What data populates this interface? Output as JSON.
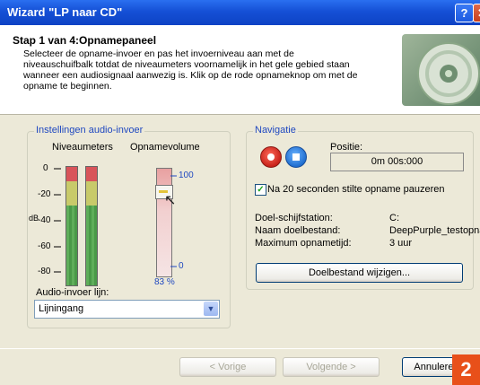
{
  "window": {
    "title": "Wizard \"LP naar CD\"",
    "help_glyph": "?",
    "close_glyph": "✕"
  },
  "header": {
    "step": "Stap 1 van 4:Opnamepaneel",
    "desc_line1": "Selecteer de opname-invoer en pas het invoerniveau aan met de",
    "desc_line2": "niveauschuifbalk totdat de niveaumeters voornamelijk in het gele gebied staan",
    "desc_line3": "wanneer een audiosignaal aanwezig is. Klik op de rode opnameknop om met de",
    "desc_line4": "opname te beginnen."
  },
  "audio_input": {
    "group_title": "Instellingen audio-invoer",
    "meters_label": "Niveaumeters",
    "volume_label": "Opnamevolume",
    "db_unit": "dB",
    "ticks": [
      "0",
      "-20",
      "-40",
      "-60",
      "-80"
    ],
    "volume_max": "100",
    "volume_min": "0",
    "volume_percent": "83 %",
    "volume_value": 83,
    "input_line_label": "Audio-invoer lijn:",
    "input_line_value": "Lijningang"
  },
  "navigation": {
    "group_title": "Navigatie",
    "position_label": "Positie:",
    "position_value": "0m 00s:000",
    "pause_checked": true,
    "pause_label": "Na 20 seconden stilte opname pauzeren",
    "target_drive_label": "Doel-schijfstation:",
    "target_drive_value": "C:",
    "target_file_label": "Naam doelbestand:",
    "target_file_value": "DeepPurple_testopna",
    "max_time_label": "Maximum opnametijd:",
    "max_time_value": "3 uur",
    "change_target_button": "Doelbestand wijzigen..."
  },
  "footer": {
    "back": "< Vorige",
    "next": "Volgende >",
    "cancel": "Annuleren",
    "badge": "2"
  },
  "colors": {
    "accent_border": "#f5b731",
    "titlebar": "#1550d6",
    "group_title": "#1f48c0",
    "badge": "#e8501a"
  }
}
